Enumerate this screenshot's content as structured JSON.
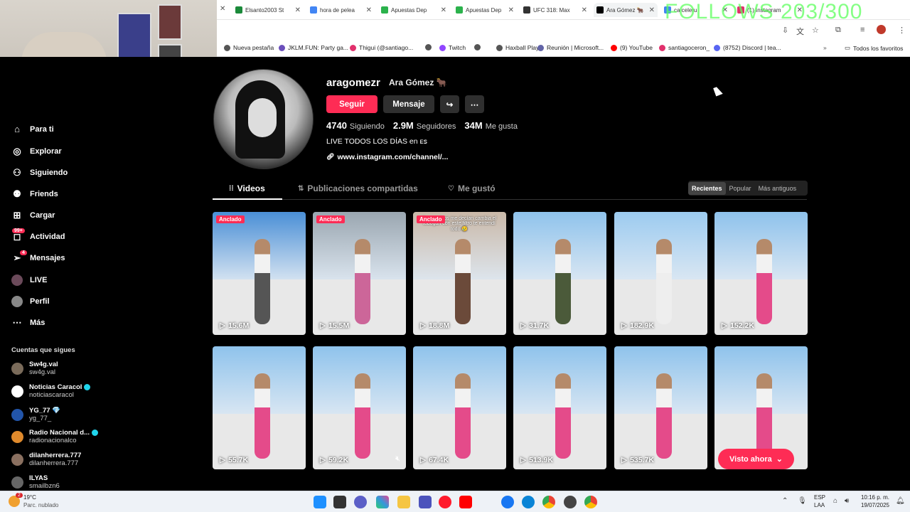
{
  "browser": {
    "tabs": [
      {
        "label": "Elsanto2003 St",
        "color": "#1b8a3a"
      },
      {
        "label": "hora de pelea",
        "color": "#4285f4"
      },
      {
        "label": "Apuestas Dep",
        "color": "#2bb24c"
      },
      {
        "label": "Apuestas Dep",
        "color": "#2bb24c"
      },
      {
        "label": "UFC 318: Max",
        "color": "#333333"
      },
      {
        "label": "Ara Gómez 🐂",
        "color": "#000000"
      },
      {
        "label": "ca celeru",
        "color": "#4285f4"
      },
      {
        "label": "(1) Instagram",
        "color": "#e1306c"
      }
    ],
    "overlay_text": "FOLLOWS 203/300",
    "bookmarks": [
      {
        "label": "Nueva pestaña",
        "color": "#555555"
      },
      {
        "label": "JKLM.FUN: Party ga...",
        "color": "#6b4fbb"
      },
      {
        "label": "Thigui (@santiago...",
        "color": "#e1306c"
      },
      {
        "label": "",
        "color": "#555555"
      },
      {
        "label": "Twitch",
        "color": "#9146ff"
      },
      {
        "label": "",
        "color": "#555555"
      },
      {
        "label": "Haxball Play",
        "color": "#555555"
      },
      {
        "label": "Reunión | Microsoft...",
        "color": "#6264a7"
      },
      {
        "label": "(9) YouTube",
        "color": "#ff0000"
      },
      {
        "label": "santiagoceron_",
        "color": "#e1306c"
      },
      {
        "label": "(8752) Discord | tea...",
        "color": "#5865f2"
      }
    ],
    "all_favorites": "Todos los favoritos"
  },
  "sidebar": {
    "items": [
      {
        "label": "Para ti",
        "icon": "home-icon",
        "glyph": "⌂"
      },
      {
        "label": "Explorar",
        "icon": "compass-icon",
        "glyph": "◎"
      },
      {
        "label": "Siguiendo",
        "icon": "user-follow-icon",
        "glyph": "⚇"
      },
      {
        "label": "Friends",
        "icon": "friends-icon",
        "glyph": "⚉"
      },
      {
        "label": "Cargar",
        "icon": "upload-icon",
        "glyph": "⊞"
      },
      {
        "label": "Actividad",
        "icon": "activity-icon",
        "glyph": "◻"
      },
      {
        "label": "Mensajes",
        "icon": "send-icon",
        "glyph": "➢"
      },
      {
        "label": "LIVE",
        "icon": "live-avatar-icon",
        "glyph": "●"
      },
      {
        "label": "Perfil",
        "icon": "profile-avatar-icon",
        "glyph": "●"
      },
      {
        "label": "Más",
        "icon": "more-dots-icon",
        "glyph": "⋯"
      }
    ],
    "activity_badge": "99+",
    "messages_badge": "4",
    "following_title": "Cuentas que sigues",
    "accounts": [
      {
        "name": "Sw4g.val",
        "handle": "sw4g.val",
        "verified": false,
        "color": "#7a6b5a"
      },
      {
        "name": "Noticias Caracol",
        "handle": "noticiascaracol",
        "verified": true,
        "color": "#ffffff"
      },
      {
        "name": "YG_77 💎",
        "handle": "yg_77_",
        "verified": false,
        "color": "#2255aa"
      },
      {
        "name": "Radio Nacional d...",
        "handle": "radionacionalco",
        "verified": true,
        "color": "#e08a2c"
      },
      {
        "name": "dilanherrera.777",
        "handle": "dilanherrera.777",
        "verified": false,
        "color": "#8a7060"
      },
      {
        "name": "ILYAS",
        "handle": "smailbzn6",
        "verified": false,
        "color": "#666666"
      }
    ]
  },
  "profile": {
    "username": "aragomezr",
    "display_name": "Ara Gómez 🐂",
    "follow_button": "Seguir",
    "message_button": "Mensaje",
    "following_count": "4740",
    "following_label": "Siguiendo",
    "followers_count": "2.9M",
    "followers_label": "Seguidores",
    "likes_count": "34M",
    "likes_label": "Me gusta",
    "bio": "LIVE TODOS LOS DÍAS en ᴇꜱ",
    "link": "www.instagram.com/channel/..."
  },
  "content_tabs": [
    {
      "label": "Videos",
      "icon": "grid-icon",
      "glyph": "⁞⁞"
    },
    {
      "label": "Publicaciones compartidas",
      "icon": "repost-icon",
      "glyph": "⇅"
    },
    {
      "label": "Me gustó",
      "icon": "heart-outline-icon",
      "glyph": "♡"
    }
  ],
  "sort_options": [
    "Recientes",
    "Popular",
    "Más antiguos"
  ],
  "videos": [
    {
      "views": "15.6M",
      "pinned": true,
      "caption": "",
      "sky": "#4a8fd6",
      "outfit": "#555555"
    },
    {
      "views": "15.5M",
      "pinned": true,
      "caption": "",
      "sky": "#9aa6b0",
      "outfit": "#cc6699"
    },
    {
      "views": "18.8M",
      "pinned": true,
      "caption": "Tus equipos me decían cambia el tobogán con este filtro te entendí todo 😢",
      "sky": "#c9b8a8",
      "outfit": "#6b4a3a"
    },
    {
      "views": "31.7K",
      "pinned": false,
      "caption": "",
      "sky": "#8fc3ec",
      "outfit": "#4b5a3a"
    },
    {
      "views": "182.9K",
      "pinned": false,
      "caption": "",
      "sky": "#9ccbf0",
      "outfit": "#eeeeee"
    },
    {
      "views": "152.2K",
      "pinned": false,
      "caption": "",
      "sky": "#8ec2ec",
      "outfit": "#e44b8a"
    },
    {
      "views": "55.7K",
      "pinned": false,
      "caption": "",
      "sky": "#8fc3ec",
      "outfit": "#e44b8a"
    },
    {
      "views": "59.2K",
      "pinned": false,
      "caption": "",
      "sky": "#8fc3ec",
      "outfit": "#e44b8a"
    },
    {
      "views": "67.4K",
      "pinned": false,
      "caption": "",
      "sky": "#8fc3ec",
      "outfit": "#e44b8a"
    },
    {
      "views": "513.9K",
      "pinned": false,
      "caption": "",
      "sky": "#8fc3ec",
      "outfit": "#e44b8a"
    },
    {
      "views": "535.7K",
      "pinned": false,
      "caption": "",
      "sky": "#8fc3ec",
      "outfit": "#e44b8a"
    },
    {
      "views": "",
      "pinned": false,
      "caption": "",
      "sky": "#8fc3ec",
      "outfit": "#e44b8a"
    }
  ],
  "pinned_label": "Anclado",
  "visto_ahora": "Visto ahora",
  "taskbar": {
    "weather_temp": "19°C",
    "weather_desc": "Parc. nublado",
    "weather_badge": "2",
    "lang_top": "ESP",
    "lang_bottom": "LAA",
    "time": "10:16 p. m.",
    "date": "19/07/2025"
  },
  "colors": {
    "accent": "#fe2c55",
    "background": "#000000"
  }
}
